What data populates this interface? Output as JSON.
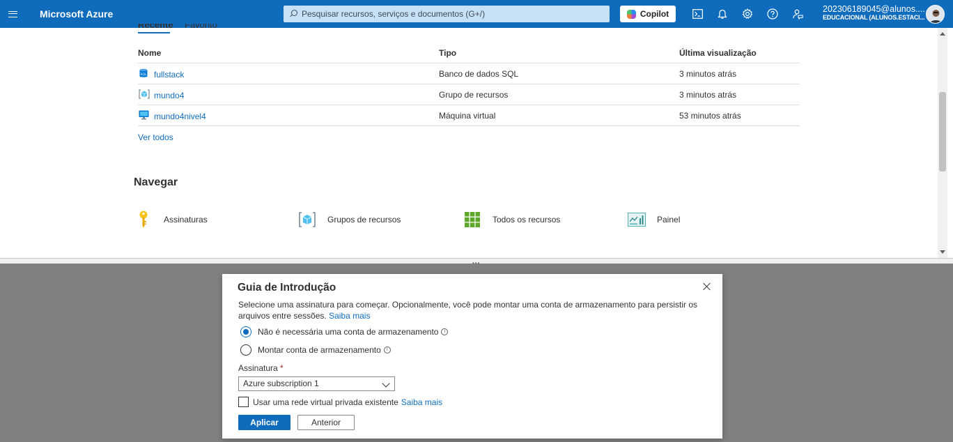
{
  "header": {
    "menu_icon": "hamburger-icon",
    "brand": "Microsoft Azure",
    "search_placeholder": "Pesquisar recursos, serviços e documentos (G+/)",
    "copilot_label": "Copilot",
    "icons": [
      "cloud-shell-icon",
      "bell-icon",
      "gear-icon",
      "help-icon",
      "feedback-icon"
    ],
    "account_email": "202306189045@alunos....",
    "account_tenant": "EDUCACIONAL (ALUNOS.ESTACI..."
  },
  "recent": {
    "tabs": [
      "Recente",
      "Favorito"
    ],
    "columns": [
      "Nome",
      "Tipo",
      "Última visualização"
    ],
    "rows": [
      {
        "name": "fullstack",
        "type": "Banco de dados SQL",
        "last": "3 minutos atrás",
        "icon": "sql-database-icon"
      },
      {
        "name": "mundo4",
        "type": "Grupo de recursos",
        "last": "3 minutos atrás",
        "icon": "resource-group-icon"
      },
      {
        "name": "mundo4nivel4",
        "type": "Máquina virtual",
        "last": "53 minutos atrás",
        "icon": "virtual-machine-icon"
      }
    ],
    "see_all": "Ver todos"
  },
  "navigate": {
    "title": "Navegar",
    "items": [
      {
        "label": "Assinaturas",
        "icon": "key-icon"
      },
      {
        "label": "Grupos de recursos",
        "icon": "resource-group-icon"
      },
      {
        "label": "Todos os recursos",
        "icon": "grid-icon"
      },
      {
        "label": "Painel",
        "icon": "dashboard-icon"
      }
    ]
  },
  "dialog": {
    "title": "Guia de Introdução",
    "description": "Selecione uma assinatura para começar. Opcionalmente, você pode montar uma conta de armazenamento para persistir os arquivos entre sessões.",
    "learn_more": "Saiba mais",
    "options": [
      {
        "label": "Não é necessária uma conta de armazenamento",
        "selected": true
      },
      {
        "label": "Montar conta de armazenamento",
        "selected": false
      }
    ],
    "subscription_label": "Assinatura",
    "required_mark": "*",
    "subscription_value": "Azure subscription 1",
    "vnet_label": "Usar uma rede virtual privada existente",
    "vnet_learn_more": "Saiba mais",
    "vnet_checked": false,
    "apply_label": "Aplicar",
    "back_label": "Anterior",
    "info_glyph": "i"
  },
  "colors": {
    "accent": "#0f6cbd",
    "shell_background": "#808080"
  }
}
